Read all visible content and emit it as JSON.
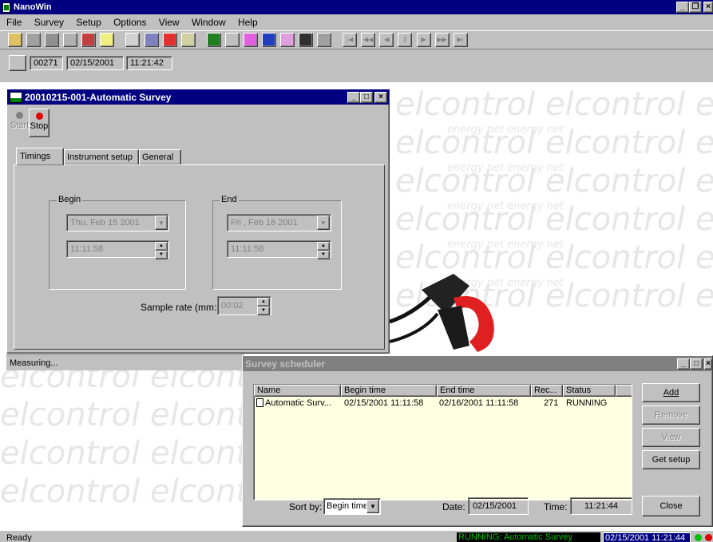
{
  "app": {
    "title": "NanoWin"
  },
  "menu": [
    "File",
    "Survey",
    "Setup",
    "Options",
    "View",
    "Window",
    "Help"
  ],
  "toolbar2": {
    "counter": "00271",
    "date": "02/15/2001",
    "time": "11:21:42"
  },
  "survey_window": {
    "title": "20010215-001-Automatic Survey",
    "start_label": "Start",
    "stop_label": "Stop",
    "tabs": [
      "Timings",
      "Instrument setup",
      "General"
    ],
    "begin": {
      "label": "Begin",
      "date": "Thu, Feb 15 2001",
      "time": "11:11:58"
    },
    "end": {
      "label": "End",
      "date": "Fri , Feb 16 2001",
      "time": "11:11:58"
    },
    "sample_rate_label": "Sample rate (mm:ss):",
    "sample_rate_value": "00:02",
    "status": "Measuring..."
  },
  "background_text": {
    "brand": "elcontrol",
    "tagline": "energy net"
  },
  "scheduler": {
    "title": "Survey scheduler",
    "columns": [
      "Name",
      "Begin time",
      "End time",
      "Rec...",
      "Status"
    ],
    "rows": [
      {
        "name": "Automatic Surv...",
        "begin": "02/15/2001 11:11:58",
        "end": "02/16/2001 11:11:58",
        "rec": "271",
        "status": "RUNNING"
      }
    ],
    "buttons": {
      "add": "Add",
      "remove": "Remove",
      "view": "View",
      "get_setup": "Get setup",
      "close": "Close"
    },
    "sort_label": "Sort by:",
    "sort_value": "Begin time",
    "date_label": "Date:",
    "date_value": "02/15/2001",
    "time_label": "Time:",
    "time_value": "11:21:44"
  },
  "statusbar": {
    "text": "Ready",
    "running": "RUNNING: Automatic Survey",
    "datetime": "02/15/2001 11:21:44"
  },
  "colors": {
    "title_active": "#000080",
    "title_inactive": "#808080",
    "face": "#c0c0c0",
    "list_bg": "#ffffe1",
    "status_green": "#00ff00"
  }
}
